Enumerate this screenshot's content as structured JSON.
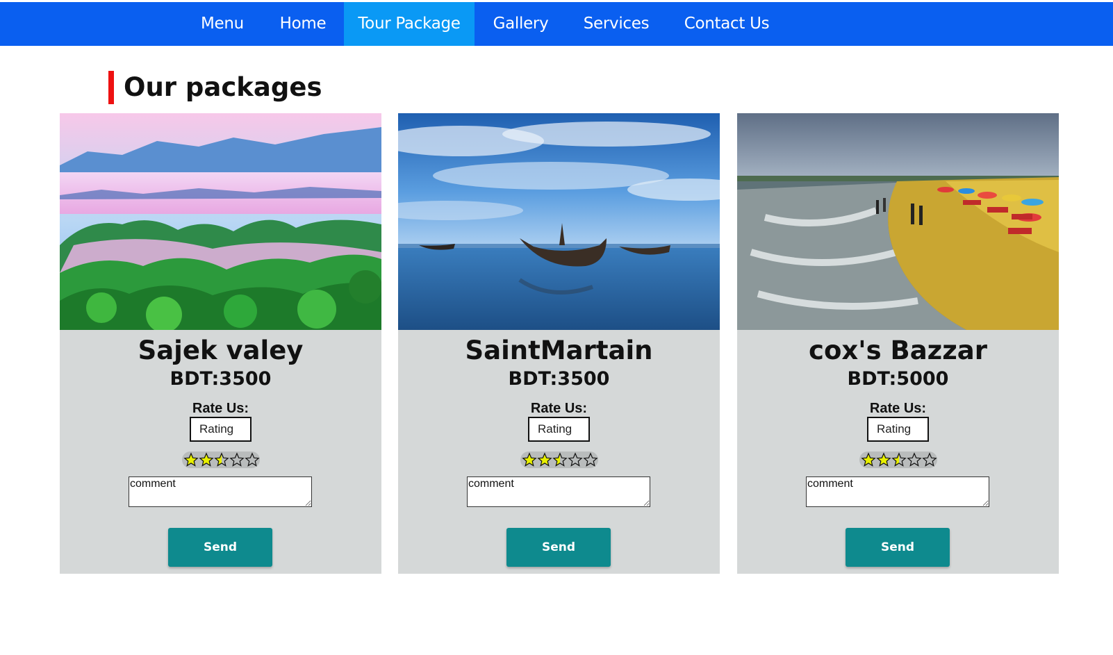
{
  "nav": {
    "items": [
      {
        "label": "Menu"
      },
      {
        "label": "Home"
      },
      {
        "label": "Tour Package",
        "active": true
      },
      {
        "label": "Gallery"
      },
      {
        "label": "Services"
      },
      {
        "label": "Contact Us"
      }
    ]
  },
  "section": {
    "title": "Our packages"
  },
  "cards": [
    {
      "title": "Sajek valey",
      "price": "BDT:3500",
      "rate_label": "Rate Us:",
      "rating_placeholder": "Rating",
      "stars_filled": 2.5,
      "stars_total": 5,
      "comment_placeholder": "comment",
      "send_label": "Send",
      "image": "misty-mountain-valley"
    },
    {
      "title": "SaintMartain",
      "price": "BDT:3500",
      "rate_label": "Rate Us:",
      "rating_placeholder": "Rating",
      "stars_filled": 2.5,
      "stars_total": 5,
      "comment_placeholder": "comment",
      "send_label": "Send",
      "image": "boats-on-beach"
    },
    {
      "title": "cox's Bazzar",
      "price": "BDT:5000",
      "rate_label": "Rate Us:",
      "rating_placeholder": "Rating",
      "stars_filled": 2.5,
      "stars_total": 5,
      "comment_placeholder": "comment",
      "send_label": "Send",
      "image": "sea-beach-shore"
    }
  ],
  "colors": {
    "nav_bg": "#0a5ff0",
    "nav_active": "#0a99f5",
    "accent_bar": "#ee1111",
    "card_bg": "#d5d8d8",
    "button": "#0e8a8e",
    "star_fill": "#e8f000"
  }
}
